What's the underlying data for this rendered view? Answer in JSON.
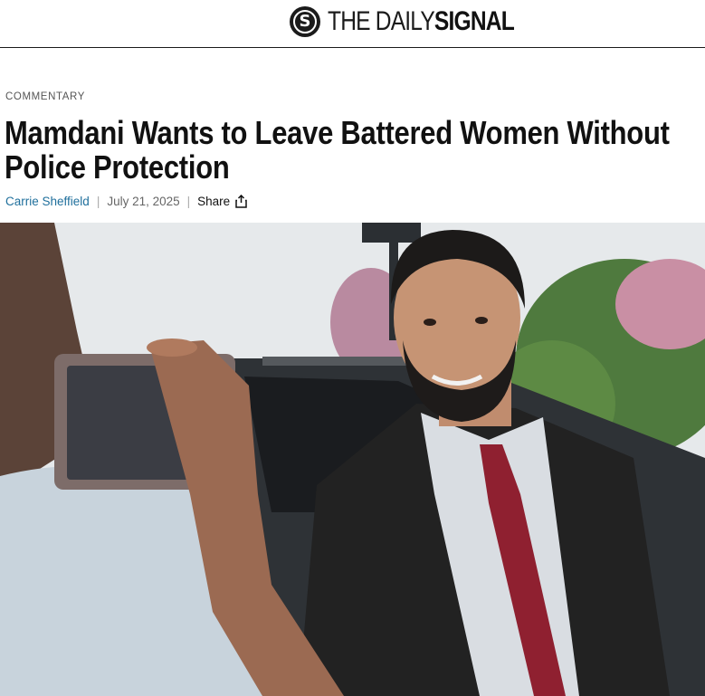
{
  "header": {
    "logo_mark": "S",
    "logo_light": "THE DAILY ",
    "logo_bold": "SIGNAL"
  },
  "article": {
    "category": "COMMENTARY",
    "title": "Mamdani Wants to Leave Battered Women Without Police Protection",
    "author": "Carrie Sheffield",
    "separator": "|",
    "date": "July 21, 2025",
    "share_label": "Share"
  },
  "colors": {
    "author_link": "#1f6f9c",
    "rule": "#1a1a1a"
  },
  "icons": {
    "share": "share-upload-icon",
    "logo": "daily-signal-logo-mark"
  }
}
